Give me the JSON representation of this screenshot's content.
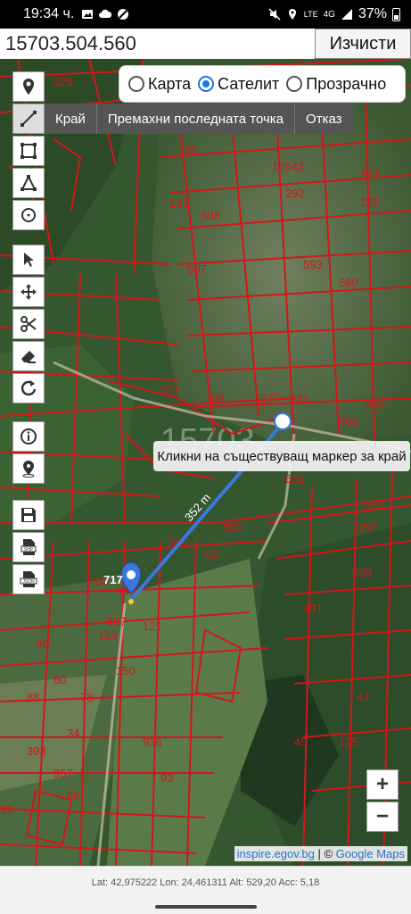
{
  "status_bar": {
    "time": "19:34 ч.",
    "network_label": "4G",
    "volte_label": "LTE",
    "battery": "37%"
  },
  "search": {
    "value": "15703.504.560",
    "clear_label": "Изчисти"
  },
  "map_type": {
    "options": [
      "Карта",
      "Сателит",
      "Прозрачно"
    ],
    "selected": "Сателит"
  },
  "measure_bar": {
    "finish_label": "Край",
    "remove_last_label": "Премахни последната точка",
    "cancel_label": "Отказ"
  },
  "tools": [
    "location-pin-icon",
    "polyline-icon",
    "rectangle-icon",
    "polygon-icon",
    "circle-icon",
    "pointer-icon",
    "move-icon",
    "scissors-icon",
    "eraser-icon",
    "undo-icon",
    "info-icon",
    "pin-marker-icon",
    "save-icon",
    "shp-file-icon",
    "json-file-icon"
  ],
  "map": {
    "distance_label": "352 m",
    "marker_label": "717",
    "hint_text": "Кликни на съществуващ маркер за край",
    "parcel_labels": [
      "326",
      "181",
      "131",
      "10542",
      "271",
      "269",
      "292",
      "508",
      "507",
      "593",
      "580",
      "1077",
      "681",
      "662",
      "632",
      "550",
      "500",
      "553",
      "457",
      "699",
      "708",
      "521",
      "426",
      "459",
      "494",
      "507",
      "491",
      "121",
      "47",
      "34",
      "393",
      "53",
      "150",
      "45",
      "125",
      "95",
      "957",
      "936",
      "93",
      "68",
      "125",
      "96",
      "60",
      "88",
      "78"
    ],
    "watermark": "15703",
    "parcel_color": "#d3161c",
    "line_color": "#3a78e0"
  },
  "zoom": {
    "in_label": "+",
    "out_label": "−"
  },
  "attribution": {
    "source_link": "inspire.egov.bg",
    "separator": " | © ",
    "maps_link": "Google Maps"
  },
  "gps": {
    "text": "Lat: 42,975222 Lon: 24,461311 Alt: 529,20 Acc: 5,18"
  }
}
